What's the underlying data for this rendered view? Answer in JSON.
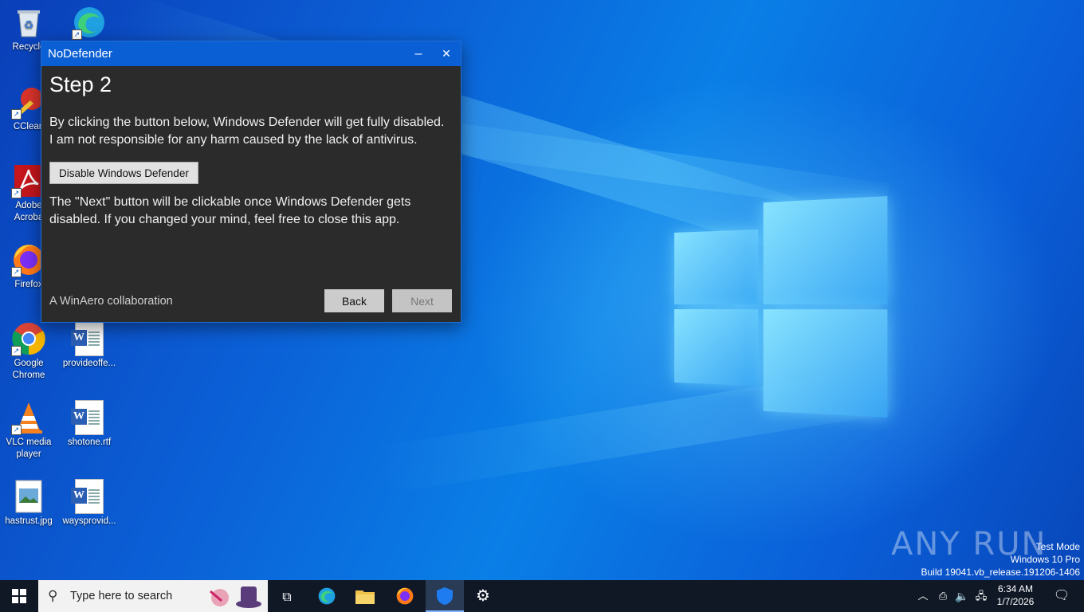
{
  "desktop": {
    "icons": [
      {
        "label": "Recycle",
        "icon": "recycle-bin-icon"
      },
      {
        "label": "",
        "icon": "edge-icon"
      },
      {
        "label": "CClean",
        "icon": "ccleaner-icon"
      },
      {
        "label": "Adobe Acroba",
        "icon": "acrobat-icon"
      },
      {
        "label": "Firefox",
        "icon": "firefox-icon"
      },
      {
        "label": "Google Chrome",
        "icon": "chrome-icon"
      },
      {
        "label": "provideoffe...",
        "icon": "word-doc-icon"
      },
      {
        "label": "VLC media player",
        "icon": "vlc-icon"
      },
      {
        "label": "shotone.rtf",
        "icon": "word-doc-icon"
      },
      {
        "label": "hastrust.jpg",
        "icon": "image-file-icon"
      },
      {
        "label": "waysprovid...",
        "icon": "word-doc-icon"
      }
    ],
    "watermark": {
      "line1": "Test Mode",
      "line2": "Windows 10 Pro",
      "line3": "Build 19041.vb_release.191206-1406"
    },
    "anyrun_logo": "ANY RUN"
  },
  "app": {
    "title": "NoDefender",
    "minimize_glyph": "‒",
    "close_glyph": "✕",
    "step_title": "Step 2",
    "paragraph1_line1": "By clicking the button below, Windows Defender will get fully disabled.",
    "paragraph1_line2": "I am not responsible for any harm caused by the lack of antivirus.",
    "disable_button": "Disable Windows Defender",
    "paragraph2_line1": "The \"Next\" button will be clickable once Windows Defender gets",
    "paragraph2_line2": "disabled. If you changed your mind, feel free to close this app.",
    "credit": "A WinAero collaboration",
    "back_button": "Back",
    "next_button": "Next"
  },
  "taskbar": {
    "search_placeholder": "Type here to search",
    "time": "6:34 AM",
    "date": "1/7/2026",
    "accent": "#0a5fd4"
  }
}
